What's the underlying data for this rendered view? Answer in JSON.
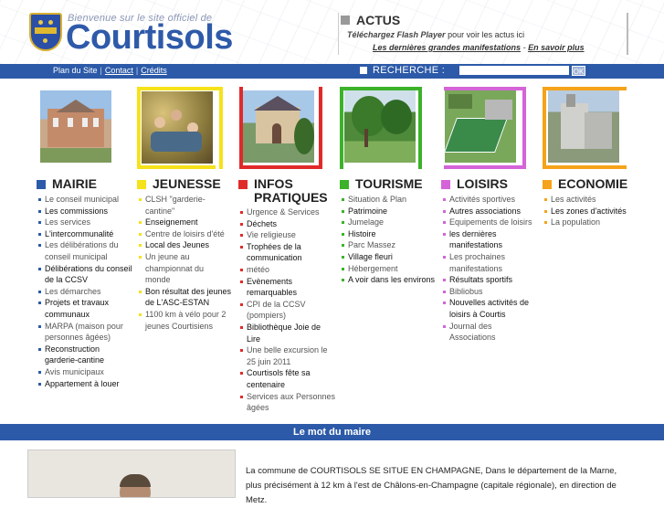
{
  "header": {
    "welcome": "Bienvenue sur le site officiel de",
    "brand": "Courtisols",
    "actus": {
      "title": "ACTUS",
      "flash_link": "Téléchargez Flash Player",
      "flash_text": " pour voir les actus ici",
      "manif_link": "Les dernières grandes manifestations",
      "sep": " - ",
      "more_link": "En savoir plus"
    }
  },
  "navbar": {
    "links": [
      "Plan du Site",
      "Contact",
      "Crédits"
    ],
    "search_label": "RECHERCHE :",
    "search_value": "",
    "ok_label": "OK"
  },
  "colors": {
    "mairie": "#2c5aa8",
    "jeunesse": "#f5e21a",
    "infos": "#e02a2a",
    "tourisme": "#3cb22a",
    "loisirs": "#d464d8",
    "economie": "#f5a31a",
    "nav": "#2c5aa8"
  },
  "columns": [
    {
      "key": "mairie",
      "title": "MAIRIE",
      "items": [
        {
          "t": "Le conseil municipal",
          "dk": false
        },
        {
          "t": "Les commissions",
          "dk": true
        },
        {
          "t": "Les services",
          "dk": false
        },
        {
          "t": "L'intercommunalité",
          "dk": true
        },
        {
          "t": "Les délibérations du",
          "dk": false
        },
        {
          "t": "conseil municipal",
          "dk": false,
          "cont": true
        },
        {
          "t": "Délibérations du conseil",
          "dk": true
        },
        {
          "t": "de la CCSV",
          "dk": true,
          "cont": true
        },
        {
          "t": "Les démarches",
          "dk": false
        },
        {
          "t": "Projets et travaux",
          "dk": true
        },
        {
          "t": "communaux",
          "dk": true,
          "cont": true
        },
        {
          "t": "MARPA (maison pour",
          "dk": false
        },
        {
          "t": "personnes âgées)",
          "dk": false,
          "cont": true
        },
        {
          "t": "Reconstruction",
          "dk": true
        },
        {
          "t": "garderie-cantine",
          "dk": true,
          "cont": true
        },
        {
          "t": "Avis municipaux",
          "dk": false
        },
        {
          "t": "Appartement à louer",
          "dk": true
        }
      ]
    },
    {
      "key": "jeunesse",
      "title": "JEUNESSE",
      "items": [
        {
          "t": "CLSH \"garderie-",
          "dk": false
        },
        {
          "t": "cantine\"",
          "dk": false,
          "cont": true
        },
        {
          "t": "Enseignement",
          "dk": true
        },
        {
          "t": "Centre de loisirs d'été",
          "dk": false
        },
        {
          "t": "Local des Jeunes",
          "dk": true
        },
        {
          "t": "Un jeune au",
          "dk": false
        },
        {
          "t": "championnat du",
          "dk": false,
          "cont": true
        },
        {
          "t": "monde",
          "dk": false,
          "cont": true
        },
        {
          "t": "Bon résultat des jeunes",
          "dk": true
        },
        {
          "t": "de L'ASC-ESTAN",
          "dk": true,
          "cont": true
        },
        {
          "t": "1100 km à vélo pour 2",
          "dk": false
        },
        {
          "t": "jeunes Courtisiens",
          "dk": false,
          "cont": true
        }
      ]
    },
    {
      "key": "infos",
      "title": "INFOS",
      "title2": "PRATIQUES",
      "items": [
        {
          "t": "Urgence & Services",
          "dk": false
        },
        {
          "t": "Déchets",
          "dk": true
        },
        {
          "t": "Vie religieuse",
          "dk": false
        },
        {
          "t": "Trophées de la",
          "dk": true
        },
        {
          "t": "communication",
          "dk": true,
          "cont": true
        },
        {
          "t": "météo",
          "dk": false
        },
        {
          "t": "Evènements",
          "dk": true
        },
        {
          "t": "remarquables",
          "dk": true,
          "cont": true
        },
        {
          "t": "CPI de la CCSV",
          "dk": false
        },
        {
          "t": "(pompiers)",
          "dk": false,
          "cont": true
        },
        {
          "t": "Bibliothèque Joie de",
          "dk": true
        },
        {
          "t": "Lire",
          "dk": true,
          "cont": true
        },
        {
          "t": "Une belle excursion le",
          "dk": false
        },
        {
          "t": "25 juin 2011",
          "dk": false,
          "cont": true
        },
        {
          "t": "Courtisols fête sa",
          "dk": true
        },
        {
          "t": "centenaire",
          "dk": true,
          "cont": true
        },
        {
          "t": "Services aux Personnes",
          "dk": false
        },
        {
          "t": "âgées",
          "dk": false,
          "cont": true
        }
      ]
    },
    {
      "key": "tourisme",
      "title": "TOURISME",
      "items": [
        {
          "t": "Situation & Plan",
          "dk": false
        },
        {
          "t": "Patrimoine",
          "dk": true
        },
        {
          "t": "Jumelage",
          "dk": false
        },
        {
          "t": "Histoire",
          "dk": true
        },
        {
          "t": "Parc Massez",
          "dk": false
        },
        {
          "t": "Village fleuri",
          "dk": true
        },
        {
          "t": "Hébergement",
          "dk": false
        },
        {
          "t": "A voir dans les environs",
          "dk": true
        }
      ]
    },
    {
      "key": "loisirs",
      "title": "LOISIRS",
      "items": [
        {
          "t": "Activités sportives",
          "dk": false
        },
        {
          "t": "Autres associations",
          "dk": true
        },
        {
          "t": "Equipements de loisirs",
          "dk": false
        },
        {
          "t": "les dernières",
          "dk": true
        },
        {
          "t": "manifestations",
          "dk": true,
          "cont": true
        },
        {
          "t": "Les prochaines",
          "dk": false
        },
        {
          "t": "manifestations",
          "dk": false,
          "cont": true
        },
        {
          "t": "Résultats sportifs",
          "dk": true
        },
        {
          "t": "Bibliobus",
          "dk": false
        },
        {
          "t": "Nouvelles activités de",
          "dk": true
        },
        {
          "t": "loisirs à Courtis",
          "dk": true,
          "cont": true
        },
        {
          "t": "Journal des",
          "dk": false
        },
        {
          "t": "Associations",
          "dk": false,
          "cont": true
        }
      ]
    },
    {
      "key": "economie",
      "title": "ECONOMIE",
      "items": [
        {
          "t": "Les activités",
          "dk": false
        },
        {
          "t": "Les zones d'activités",
          "dk": true
        },
        {
          "t": "La population",
          "dk": false
        }
      ]
    }
  ],
  "mot": {
    "title": "Le mot du maire",
    "text": "La commune de COURTISOLS SE SITUE EN CHAMPAGNE, Dans le département de la Marne, plus précisément à 12 km à l'est de Châlons-en-Champagne (capitale régionale), en direction de Metz."
  }
}
